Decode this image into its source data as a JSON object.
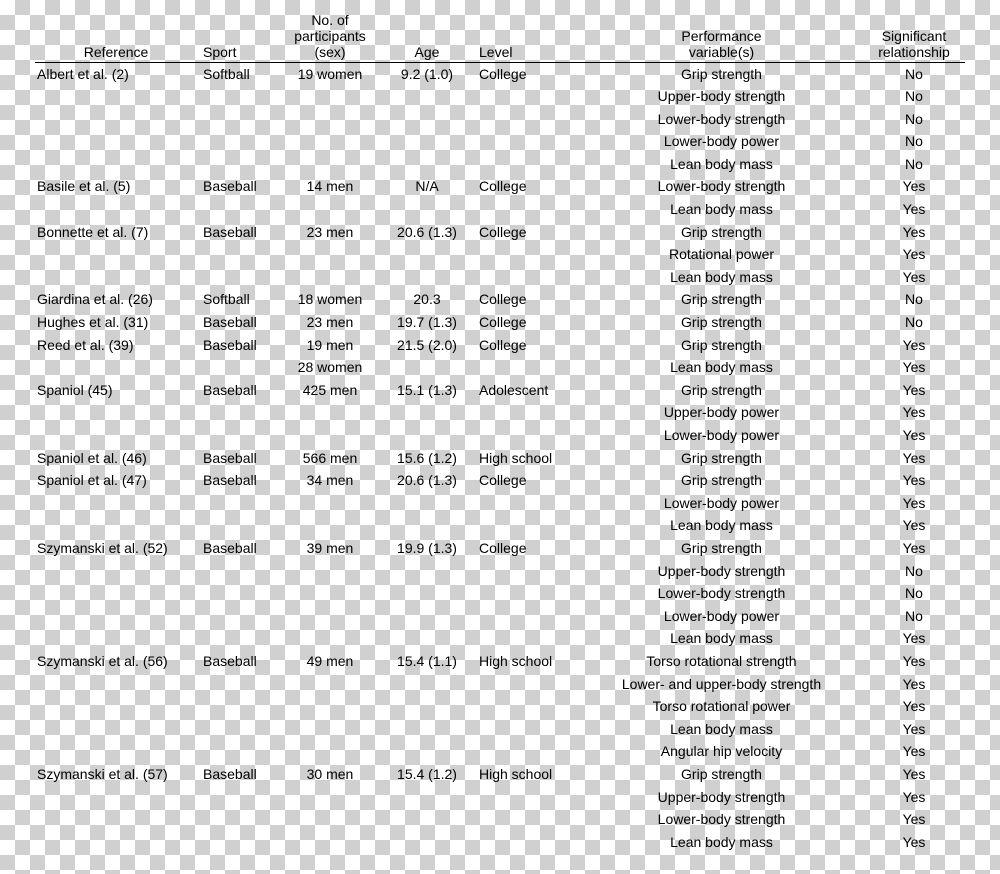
{
  "headers": {
    "reference": "Reference",
    "sport": "Sport",
    "participants": "No. of\nparticipants\n(sex)",
    "age": "Age",
    "level": "Level",
    "performance": "Performance\nvariable(s)",
    "significant": "Significant\nrelationship"
  },
  "rows": [
    {
      "reference": "Albert et al. (2)",
      "sport": "Softball",
      "participants": "19 women",
      "age": "9.2 (1.0)",
      "level": "College",
      "performance": "Grip strength",
      "significant": "No"
    },
    {
      "reference": "",
      "sport": "",
      "participants": "",
      "age": "",
      "level": "",
      "performance": "Upper-body strength",
      "significant": "No"
    },
    {
      "reference": "",
      "sport": "",
      "participants": "",
      "age": "",
      "level": "",
      "performance": "Lower-body strength",
      "significant": "No"
    },
    {
      "reference": "",
      "sport": "",
      "participants": "",
      "age": "",
      "level": "",
      "performance": "Lower-body power",
      "significant": "No"
    },
    {
      "reference": "",
      "sport": "",
      "participants": "",
      "age": "",
      "level": "",
      "performance": "Lean body mass",
      "significant": "No"
    },
    {
      "reference": "Basile et al. (5)",
      "sport": "Baseball",
      "participants": "14 men",
      "age": "N/A",
      "level": "College",
      "performance": "Lower-body strength",
      "significant": "Yes"
    },
    {
      "reference": "",
      "sport": "",
      "participants": "",
      "age": "",
      "level": "",
      "performance": "Lean body mass",
      "significant": "Yes"
    },
    {
      "reference": "Bonnette et al. (7)",
      "sport": "Baseball",
      "participants": "23 men",
      "age": "20.6 (1.3)",
      "level": "College",
      "performance": "Grip strength",
      "significant": "Yes"
    },
    {
      "reference": "",
      "sport": "",
      "participants": "",
      "age": "",
      "level": "",
      "performance": "Rotational power",
      "significant": "Yes"
    },
    {
      "reference": "",
      "sport": "",
      "participants": "",
      "age": "",
      "level": "",
      "performance": "Lean body mass",
      "significant": "Yes"
    },
    {
      "reference": "Giardina et al. (26)",
      "sport": "Softball",
      "participants": "18 women",
      "age": "20.3",
      "level": "College",
      "performance": "Grip strength",
      "significant": "No"
    },
    {
      "reference": "Hughes et al. (31)",
      "sport": "Baseball",
      "participants": "23 men",
      "age": "19.7 (1.3)",
      "level": "College",
      "performance": "Grip strength",
      "significant": "No"
    },
    {
      "reference": "Reed et al. (39)",
      "sport": "Baseball",
      "participants": "19 men",
      "age": "21.5 (2.0)",
      "level": "College",
      "performance": "Grip strength",
      "significant": "Yes"
    },
    {
      "reference": "",
      "sport": "",
      "participants": "28 women",
      "age": "",
      "level": "",
      "performance": "Lean body mass",
      "significant": "Yes"
    },
    {
      "reference": "Spaniol (45)",
      "sport": "Baseball",
      "participants": "425 men",
      "age": "15.1 (1.3)",
      "level": "Adolescent",
      "performance": "Grip strength",
      "significant": "Yes"
    },
    {
      "reference": "",
      "sport": "",
      "participants": "",
      "age": "",
      "level": "",
      "performance": "Upper-body power",
      "significant": "Yes"
    },
    {
      "reference": "",
      "sport": "",
      "participants": "",
      "age": "",
      "level": "",
      "performance": "Lower-body power",
      "significant": "Yes"
    },
    {
      "reference": "Spaniol et al. (46)",
      "sport": "Baseball",
      "participants": "566 men",
      "age": "15.6 (1.2)",
      "level": "High school",
      "performance": "Grip strength",
      "significant": "Yes"
    },
    {
      "reference": "Spaniol et al. (47)",
      "sport": "Baseball",
      "participants": "34 men",
      "age": "20.6 (1.3)",
      "level": "College",
      "performance": "Grip strength",
      "significant": "Yes"
    },
    {
      "reference": "",
      "sport": "",
      "participants": "",
      "age": "",
      "level": "",
      "performance": "Lower-body power",
      "significant": "Yes"
    },
    {
      "reference": "",
      "sport": "",
      "participants": "",
      "age": "",
      "level": "",
      "performance": "Lean body mass",
      "significant": "Yes"
    },
    {
      "reference": "Szymanski et al. (52)",
      "sport": "Baseball",
      "participants": "39 men",
      "age": "19.9 (1.3)",
      "level": "College",
      "performance": "Grip strength",
      "significant": "Yes"
    },
    {
      "reference": "",
      "sport": "",
      "participants": "",
      "age": "",
      "level": "",
      "performance": "Upper-body strength",
      "significant": "No"
    },
    {
      "reference": "",
      "sport": "",
      "participants": "",
      "age": "",
      "level": "",
      "performance": "Lower-body strength",
      "significant": "No"
    },
    {
      "reference": "",
      "sport": "",
      "participants": "",
      "age": "",
      "level": "",
      "performance": "Lower-body power",
      "significant": "No"
    },
    {
      "reference": "",
      "sport": "",
      "participants": "",
      "age": "",
      "level": "",
      "performance": "Lean body mass",
      "significant": "Yes"
    },
    {
      "reference": "Szymanski et al. (56)",
      "sport": "Baseball",
      "participants": "49 men",
      "age": "15.4 (1.1)",
      "level": "High school",
      "performance": "Torso rotational strength",
      "significant": "Yes"
    },
    {
      "reference": "",
      "sport": "",
      "participants": "",
      "age": "",
      "level": "",
      "performance": "Lower- and upper-body strength",
      "significant": "Yes"
    },
    {
      "reference": "",
      "sport": "",
      "participants": "",
      "age": "",
      "level": "",
      "performance": "Torso rotational power",
      "significant": "Yes"
    },
    {
      "reference": "",
      "sport": "",
      "participants": "",
      "age": "",
      "level": "",
      "performance": "Lean body mass",
      "significant": "Yes"
    },
    {
      "reference": "",
      "sport": "",
      "participants": "",
      "age": "",
      "level": "",
      "performance": "Angular hip velocity",
      "significant": "Yes"
    },
    {
      "reference": "Szymanski et al. (57)",
      "sport": "Baseball",
      "participants": "30 men",
      "age": "15.4 (1.2)",
      "level": "High school",
      "performance": "Grip strength",
      "significant": "Yes"
    },
    {
      "reference": "",
      "sport": "",
      "participants": "",
      "age": "",
      "level": "",
      "performance": "Upper-body strength",
      "significant": "Yes"
    },
    {
      "reference": "",
      "sport": "",
      "participants": "",
      "age": "",
      "level": "",
      "performance": "Lower-body strength",
      "significant": "Yes"
    },
    {
      "reference": "",
      "sport": "",
      "participants": "",
      "age": "",
      "level": "",
      "performance": "Lean body mass",
      "significant": "Yes"
    }
  ]
}
